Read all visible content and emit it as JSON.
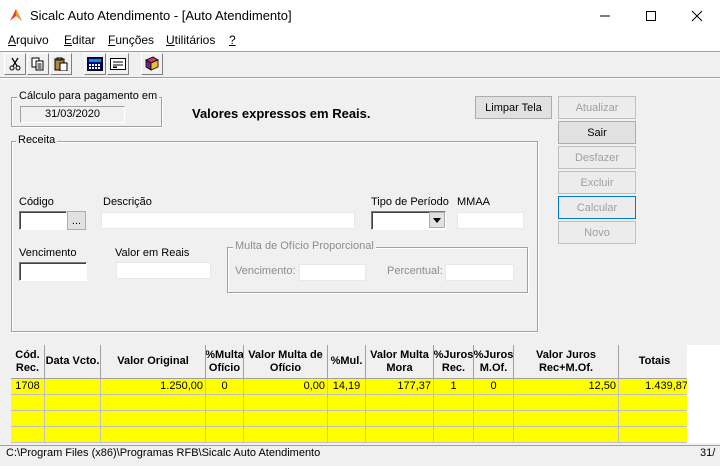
{
  "window": {
    "title": "Sicalc Auto Atendimento - [Auto Atendimento]",
    "minimize": "—",
    "maximize": "☐",
    "close": "✕"
  },
  "menu": [
    {
      "label": "Arquivo",
      "accel": "A",
      "rest": "rquivo"
    },
    {
      "label": "Editar",
      "accel": "E",
      "rest": "ditar"
    },
    {
      "label": "Funções",
      "accel": "F",
      "rest": "unções"
    },
    {
      "label": "Utilitários",
      "accel": "U",
      "rest": "tilitários"
    },
    {
      "label": "?",
      "accel": "?",
      "rest": ""
    }
  ],
  "toolbar": [
    "cut-icon",
    "copy-icon",
    "paste-icon",
    "calculator-icon",
    "card-icon",
    "book-icon"
  ],
  "calc_date": {
    "legend": "Cálculo para pagamento em",
    "value": "31/03/2020"
  },
  "heading": "Valores expressos em Reais.",
  "receita": {
    "legend": "Receita",
    "codigo_label": "Código",
    "codigo_value": "",
    "lookup_button": "...",
    "descricao_label": "Descrição",
    "descricao_value": "",
    "tipo_periodo_label": "Tipo de Período",
    "tipo_periodo_value": "",
    "mmaa_label": "MMAA",
    "mmaa_value": "",
    "vencimento_label": "Vencimento",
    "vencimento_value": "",
    "valor_label": "Valor em Reais",
    "valor_value": "",
    "multa": {
      "legend": "Multa de Ofício Proporcional",
      "vencimento_label": "Vencimento:",
      "vencimento_value": "",
      "percentual_label": "Percentual:",
      "percentual_value": ""
    }
  },
  "buttons": {
    "limpar": "Limpar Tela",
    "atualizar": "Atualizar",
    "sair": "Sair",
    "desfazer": "Desfazer",
    "excluir": "Excluir",
    "calcular": "Calcular",
    "novo": "Novo"
  },
  "grid": {
    "columns": [
      {
        "label": "Cód. Rec."
      },
      {
        "label": "Data Vcto."
      },
      {
        "label": "Valor Original"
      },
      {
        "label": "%Multa Ofício"
      },
      {
        "label": "Valor Multa de Ofício"
      },
      {
        "label": "%Mul."
      },
      {
        "label": "Valor Multa Mora"
      },
      {
        "label": "%Juros Rec."
      },
      {
        "label": "%Juros M.Of."
      },
      {
        "label": "Valor Juros Rec+M.Of."
      },
      {
        "label": "Totais"
      }
    ],
    "rows": [
      [
        "1708",
        "",
        "1.250,00",
        "0",
        "0,00",
        "14,19",
        "177,37",
        "1",
        "0",
        "12,50",
        "1.439,87"
      ],
      [
        "",
        "",
        "",
        "",
        "",
        "",
        "",
        "",
        "",
        "",
        ""
      ],
      [
        "",
        "",
        "",
        "",
        "",
        "",
        "",
        "",
        "",
        "",
        ""
      ],
      [
        "",
        "",
        "",
        "",
        "",
        "",
        "",
        "",
        "",
        "",
        ""
      ]
    ]
  },
  "status": {
    "path": "C:\\Program Files (x86)\\Programas RFB\\Sicalc Auto Atendimento",
    "date": "31/"
  }
}
